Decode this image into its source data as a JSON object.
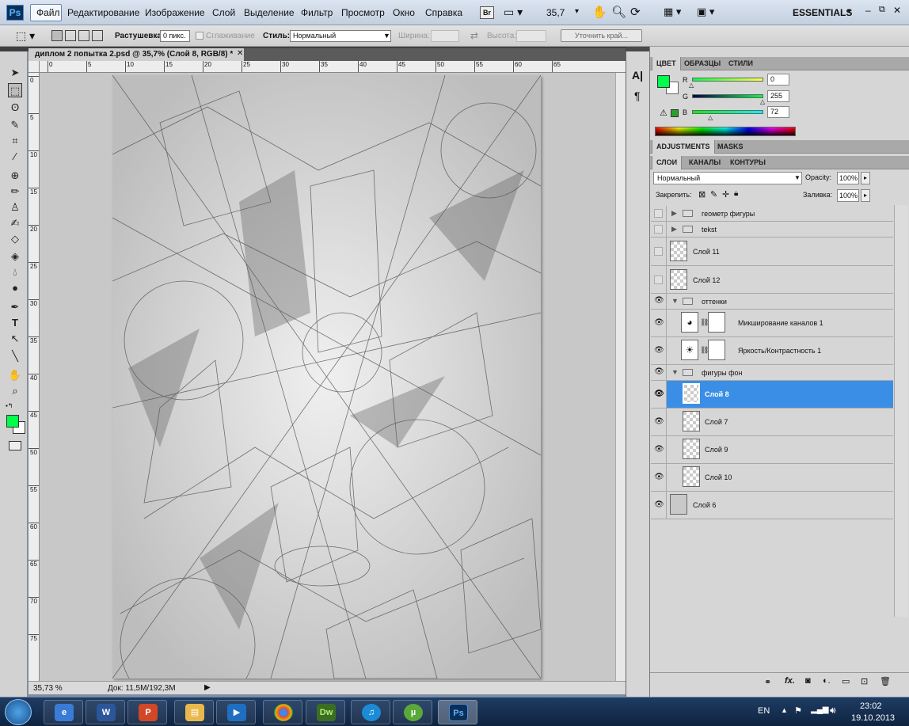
{
  "app": {
    "logo": "Ps",
    "workspace": "ESSENTIALS",
    "zoom": "35,7",
    "bridge": "Br"
  },
  "menu": [
    "Файл",
    "Редактирование",
    "Изображение",
    "Слой",
    "Выделение",
    "Фильтр",
    "Просмотр",
    "Окно",
    "Справка"
  ],
  "options": {
    "feather_label": "Растушевка:",
    "feather_value": "0 пикс.",
    "antialias_label": "Сглаживание",
    "style_label": "Стиль:",
    "style_value": "Нормальный",
    "width_label": "Ширина:",
    "height_label": "Высота:",
    "refine_label": "Уточнить край..."
  },
  "document": {
    "tab_title": "диплом 2 попытка 2.psd @ 35,7% (Слой 8, RGB/8) *",
    "status_zoom": "35,73 %",
    "status_doc": "Док: 11,5M/192,3M",
    "ruler_h": [
      "0",
      "5",
      "10",
      "15",
      "20",
      "25",
      "30",
      "35",
      "40",
      "45",
      "50",
      "55",
      "60",
      "65"
    ],
    "ruler_v": [
      "0",
      "5",
      "10",
      "15",
      "20",
      "25",
      "30",
      "35",
      "40",
      "45",
      "50",
      "55",
      "60",
      "65",
      "70",
      "75"
    ]
  },
  "color_panel": {
    "tabs": [
      "ЦВЕТ",
      "ОБРАЗЦЫ",
      "СТИЛИ"
    ],
    "r_label": "R",
    "r_value": "0",
    "r_level": 0,
    "g_label": "G",
    "g_value": "255",
    "g_level": 1,
    "b_label": "B",
    "b_value": "72",
    "b_level": 0.28,
    "foreground": "#00ff48"
  },
  "adjustments_tabs": [
    "ADJUSTMENTS",
    "MASKS"
  ],
  "layers_panel": {
    "tabs": [
      "СЛОИ",
      "КАНАЛЫ",
      "КОНТУРЫ"
    ],
    "blend_mode": "Нормальный",
    "opacity_label": "Opacity:",
    "opacity_value": "100%",
    "lock_label": "Закрепить:",
    "fill_label": "Заливка:",
    "fill_value": "100%",
    "layers": [
      {
        "name": "геометр фигуры",
        "kind": "group",
        "visible": false
      },
      {
        "name": "tekst",
        "kind": "group",
        "visible": false
      },
      {
        "name": "Слой 11",
        "kind": "layer",
        "visible": false
      },
      {
        "name": "Слой 12",
        "kind": "layer",
        "visible": false
      },
      {
        "name": "оттенки",
        "kind": "group-open",
        "visible": true
      },
      {
        "name": "Микширование каналов 1",
        "kind": "adjustment",
        "visible": true
      },
      {
        "name": "Яркость/Контрастность 1",
        "kind": "adjustment",
        "visible": true
      },
      {
        "name": "фигуры фон",
        "kind": "group-open",
        "visible": true
      },
      {
        "name": "Слой 8",
        "kind": "layer",
        "visible": true,
        "selected": true
      },
      {
        "name": "Слой 7",
        "kind": "layer",
        "visible": true
      },
      {
        "name": "Слой 9",
        "kind": "layer",
        "visible": true
      },
      {
        "name": "Слой 10",
        "kind": "layer",
        "visible": true
      },
      {
        "name": "Слой 6",
        "kind": "layer",
        "visible": true
      }
    ]
  },
  "taskbar": {
    "apps": [
      "Windows Explorer",
      "Word",
      "PowerPoint",
      "Files",
      "Media",
      "Chrome",
      "Dreamweaver",
      "iTunes",
      "uTorrent",
      "Photoshop"
    ],
    "lang": "EN",
    "time": "23:02",
    "date": "19.10.2013"
  }
}
